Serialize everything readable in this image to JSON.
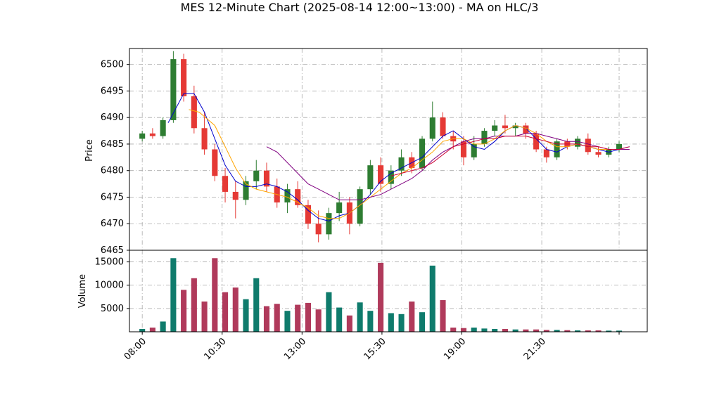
{
  "chart_data": [
    {
      "type": "candlestick",
      "title": "MES 12-Minute Chart (2025-08-14 12:00~13:00) - MA on HLC/3",
      "xlabel": "",
      "ylabel": "Price",
      "ylim": [
        6465,
        6503
      ],
      "yticks": [
        6465,
        6470,
        6475,
        6480,
        6485,
        6490,
        6495,
        6500
      ],
      "xticks": [
        {
          "label": "08:00",
          "index": 0
        },
        {
          "label": "10:30",
          "index": 12.5
        },
        {
          "label": "13:00",
          "index": 25
        },
        {
          "label": "15:30",
          "index": 37.5
        },
        {
          "label": "19:00",
          "index": 50
        },
        {
          "label": "21:30",
          "index": 62.5
        }
      ],
      "x_range": [
        -2,
        79
      ],
      "grid": true,
      "up_color": "#2e7d32",
      "down_color": "#e53935",
      "candles": [
        [
          6486.0,
          6487.5,
          6485.5,
          6487.0
        ],
        [
          6487.0,
          6488.0,
          6486.0,
          6486.5
        ],
        [
          6486.5,
          6490.0,
          6486.0,
          6489.5
        ],
        [
          6489.5,
          6502.5,
          6489.0,
          6501.0
        ],
        [
          6501.0,
          6502.0,
          6493.0,
          6494.0
        ],
        [
          6494.0,
          6496.0,
          6487.0,
          6488.0
        ],
        [
          6488.0,
          6491.0,
          6483.0,
          6484.0
        ],
        [
          6484.0,
          6485.0,
          6478.0,
          6479.0
        ],
        [
          6479.0,
          6480.5,
          6474.0,
          6476.0
        ],
        [
          6476.0,
          6478.0,
          6471.0,
          6474.5
        ],
        [
          6474.5,
          6479.0,
          6473.5,
          6478.0
        ],
        [
          6478.0,
          6482.0,
          6476.5,
          6480.0
        ],
        [
          6480.0,
          6481.5,
          6476.0,
          6477.0
        ],
        [
          6477.0,
          6478.5,
          6473.0,
          6474.0
        ],
        [
          6474.0,
          6477.5,
          6472.0,
          6476.5
        ],
        [
          6476.5,
          6478.0,
          6473.0,
          6473.5
        ],
        [
          6473.5,
          6474.5,
          6469.0,
          6470.0
        ],
        [
          6470.0,
          6472.5,
          6466.5,
          6468.0
        ],
        [
          6468.0,
          6473.0,
          6467.0,
          6472.0
        ],
        [
          6472.0,
          6476.0,
          6470.5,
          6474.0
        ],
        [
          6474.0,
          6475.0,
          6468.0,
          6470.0
        ],
        [
          6470.0,
          6477.0,
          6469.5,
          6476.5
        ],
        [
          6476.5,
          6482.0,
          6475.5,
          6481.0
        ],
        [
          6481.0,
          6482.5,
          6476.0,
          6477.5
        ],
        [
          6477.5,
          6481.0,
          6476.5,
          6480.0
        ],
        [
          6480.0,
          6484.0,
          6479.0,
          6482.5
        ],
        [
          6482.5,
          6483.5,
          6479.5,
          6480.5
        ],
        [
          6480.5,
          6486.5,
          6480.0,
          6486.0
        ],
        [
          6486.0,
          6493.0,
          6485.5,
          6490.0
        ],
        [
          6490.0,
          6491.0,
          6486.0,
          6486.5
        ],
        [
          6486.5,
          6487.5,
          6484.0,
          6485.5
        ],
        [
          6485.5,
          6486.5,
          6481.0,
          6482.5
        ],
        [
          6482.5,
          6486.5,
          6482.0,
          6485.0
        ],
        [
          6485.0,
          6488.0,
          6484.5,
          6487.5
        ],
        [
          6487.5,
          6489.5,
          6486.5,
          6488.5
        ],
        [
          6488.5,
          6490.5,
          6487.0,
          6488.0
        ],
        [
          6488.0,
          6489.0,
          6486.5,
          6488.5
        ],
        [
          6488.5,
          6489.0,
          6486.0,
          6487.0
        ],
        [
          6487.0,
          6487.5,
          6483.5,
          6484.0
        ],
        [
          6484.0,
          6484.5,
          6481.5,
          6482.5
        ],
        [
          6482.5,
          6486.0,
          6482.0,
          6485.5
        ],
        [
          6485.5,
          6486.0,
          6484.0,
          6484.5
        ],
        [
          6484.5,
          6486.5,
          6484.0,
          6486.0
        ],
        [
          6486.0,
          6487.0,
          6483.0,
          6483.5
        ],
        [
          6483.5,
          6484.5,
          6482.5,
          6483.0
        ],
        [
          6483.0,
          6484.5,
          6482.5,
          6484.0
        ],
        [
          6484.0,
          6485.5,
          6483.5,
          6485.0
        ]
      ],
      "ma_lines": [
        {
          "color": "#0000cc",
          "points": [
            [
              2.5,
              6489.0
            ],
            [
              4,
              6494.5
            ],
            [
              5,
              6494.5
            ],
            [
              6,
              6491.0
            ],
            [
              7,
              6486.0
            ],
            [
              8,
              6481.0
            ],
            [
              9,
              6478.0
            ],
            [
              10,
              6477.0
            ],
            [
              11,
              6477.0
            ],
            [
              12,
              6477.5
            ],
            [
              13,
              6477.0
            ],
            [
              14,
              6476.0
            ],
            [
              15,
              6474.5
            ],
            [
              16,
              6472.5
            ],
            [
              17,
              6471.0
            ],
            [
              18,
              6470.5
            ],
            [
              19,
              6471.5
            ],
            [
              20,
              6472.0
            ],
            [
              21,
              6473.5
            ],
            [
              22,
              6475.5
            ],
            [
              23,
              6478.0
            ],
            [
              24,
              6479.5
            ],
            [
              25,
              6480.5
            ],
            [
              26,
              6481.5
            ],
            [
              27,
              6482.5
            ],
            [
              28,
              6484.5
            ],
            [
              29,
              6486.5
            ],
            [
              30,
              6487.5
            ],
            [
              31,
              6486.0
            ],
            [
              32,
              6484.5
            ],
            [
              33,
              6484.0
            ],
            [
              34,
              6485.5
            ],
            [
              35,
              6487.5
            ],
            [
              36,
              6488.5
            ],
            [
              37,
              6488.0
            ],
            [
              38,
              6486.0
            ],
            [
              39,
              6484.0
            ],
            [
              40,
              6483.5
            ],
            [
              41,
              6484.5
            ],
            [
              42,
              6485.0
            ],
            [
              43,
              6484.5
            ],
            [
              44,
              6484.0
            ],
            [
              45,
              6483.5
            ],
            [
              46,
              6484.0
            ],
            [
              47,
              6484.5
            ]
          ]
        },
        {
          "color": "#ffa500",
          "points": [
            [
              4.5,
              6491.5
            ],
            [
              5.5,
              6491.0
            ],
            [
              7,
              6488.5
            ],
            [
              8,
              6484.5
            ],
            [
              9,
              6480.5
            ],
            [
              10,
              6477.5
            ],
            [
              11,
              6476.5
            ],
            [
              12,
              6476.0
            ],
            [
              13,
              6475.5
            ],
            [
              14,
              6475.0
            ],
            [
              15,
              6474.0
            ],
            [
              16,
              6473.0
            ],
            [
              17,
              6471.5
            ],
            [
              18,
              6471.0
            ],
            [
              19,
              6471.0
            ],
            [
              20,
              6472.0
            ],
            [
              21,
              6473.5
            ],
            [
              22,
              6475.0
            ],
            [
              23,
              6476.5
            ],
            [
              24,
              6478.0
            ],
            [
              25,
              6479.5
            ],
            [
              26,
              6480.5
            ],
            [
              27,
              6482.0
            ],
            [
              28,
              6483.5
            ],
            [
              29,
              6485.5
            ],
            [
              30,
              6486.0
            ],
            [
              31,
              6486.0
            ],
            [
              32,
              6485.0
            ],
            [
              33,
              6485.0
            ],
            [
              34,
              6486.0
            ],
            [
              35,
              6487.5
            ],
            [
              36,
              6488.5
            ],
            [
              37,
              6488.0
            ],
            [
              38,
              6487.0
            ],
            [
              39,
              6485.5
            ],
            [
              40,
              6484.5
            ],
            [
              41,
              6484.5
            ],
            [
              42,
              6485.0
            ],
            [
              43,
              6484.5
            ],
            [
              44,
              6484.0
            ],
            [
              45,
              6484.0
            ],
            [
              46,
              6484.0
            ],
            [
              47,
              6484.0
            ]
          ]
        },
        {
          "color": "#800080",
          "points": [
            [
              12,
              6484.5
            ],
            [
              13,
              6483.5
            ],
            [
              14,
              6481.5
            ],
            [
              15,
              6479.5
            ],
            [
              16,
              6477.5
            ],
            [
              17,
              6476.5
            ],
            [
              18,
              6475.5
            ],
            [
              19,
              6474.5
            ],
            [
              20,
              6474.5
            ],
            [
              21,
              6474.5
            ],
            [
              22,
              6475.0
            ],
            [
              23,
              6475.5
            ],
            [
              24,
              6476.5
            ],
            [
              25,
              6477.5
            ],
            [
              26,
              6478.5
            ],
            [
              27,
              6480.0
            ],
            [
              28,
              6482.0
            ],
            [
              29,
              6483.5
            ],
            [
              30,
              6484.5
            ],
            [
              31,
              6485.5
            ],
            [
              32,
              6486.0
            ],
            [
              33,
              6486.0
            ],
            [
              34,
              6486.5
            ],
            [
              35,
              6486.5
            ],
            [
              36,
              6486.5
            ],
            [
              37,
              6487.0
            ],
            [
              38,
              6487.0
            ],
            [
              39,
              6486.5
            ],
            [
              40,
              6486.0
            ],
            [
              41,
              6485.5
            ],
            [
              42,
              6485.5
            ],
            [
              43,
              6485.0
            ],
            [
              44,
              6484.5
            ],
            [
              45,
              6484.0
            ],
            [
              46,
              6484.0
            ],
            [
              47,
              6484.0
            ]
          ]
        },
        {
          "color": "#cc0033",
          "points": [
            [
              24,
              6479.0
            ],
            [
              25,
              6479.5
            ],
            [
              26,
              6480.0
            ],
            [
              27,
              6480.5
            ],
            [
              28,
              6481.5
            ],
            [
              29,
              6483.0
            ],
            [
              30,
              6484.5
            ],
            [
              31,
              6485.0
            ],
            [
              32,
              6485.5
            ],
            [
              33,
              6486.0
            ],
            [
              34,
              6486.0
            ],
            [
              35,
              6486.5
            ],
            [
              36,
              6486.5
            ],
            [
              37,
              6486.5
            ],
            [
              38,
              6486.0
            ],
            [
              39,
              6485.5
            ],
            [
              40,
              6485.0
            ],
            [
              41,
              6485.0
            ],
            [
              42,
              6485.0
            ],
            [
              43,
              6484.5
            ],
            [
              44,
              6484.5
            ],
            [
              45,
              6484.0
            ],
            [
              46,
              6484.0
            ],
            [
              47,
              6484.5
            ]
          ]
        }
      ]
    },
    {
      "type": "bar",
      "xlabel": "",
      "ylabel": "Volume",
      "ylim": [
        0,
        17500
      ],
      "yticks": [
        5000,
        10000,
        15000
      ],
      "grid": true,
      "values": [
        600,
        900,
        2200,
        15800,
        9000,
        11500,
        6500,
        15800,
        8500,
        9500,
        7000,
        11500,
        5500,
        6000,
        4500,
        5800,
        6200,
        4800,
        8500,
        5200,
        3500,
        6300,
        4500,
        14800,
        4000,
        3800,
        6500,
        4200,
        14200,
        6800,
        900,
        800,
        900,
        700,
        600,
        600,
        500,
        500,
        500,
        400,
        400,
        350,
        300,
        300,
        300,
        250,
        250
      ]
    }
  ]
}
